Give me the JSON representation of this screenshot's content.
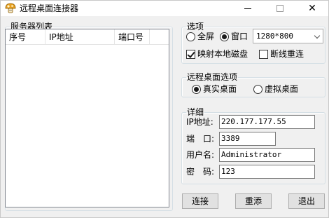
{
  "window": {
    "title": "远程桌面连接器",
    "close_glyph": "✕"
  },
  "server_list": {
    "legend": "服务器列表",
    "columns": [
      "序号",
      "IP地址",
      "端口号"
    ],
    "rows": []
  },
  "options": {
    "legend": "选项",
    "fullscreen_label": "全屏",
    "window_label": "窗口",
    "selected_mode": "窗口",
    "resolution": "1280*800",
    "map_disk_label": "映射本地磁盘",
    "map_disk_checked": true,
    "reconnect_label": "断线重连",
    "reconnect_checked": false
  },
  "desktop_options": {
    "legend": "远程桌面选项",
    "real_label": "真实桌面",
    "virtual_label": "虚拟桌面",
    "selected": "真实桌面"
  },
  "details": {
    "legend": "详细",
    "ip_label": "IP地址:",
    "ip_value": "220.177.177.55",
    "port_label": "端　口:",
    "port_value": "3389",
    "user_label": "用户名:",
    "user_value": "Administrator",
    "password_label": "密　码:",
    "password_value": "123"
  },
  "buttons": {
    "connect": "连接",
    "reset": "重添",
    "exit": "退出"
  },
  "icons": {
    "app": "mushroom-icon",
    "minimize": "minimize-icon",
    "maximize": "maximize-icon",
    "close": "close-icon"
  }
}
